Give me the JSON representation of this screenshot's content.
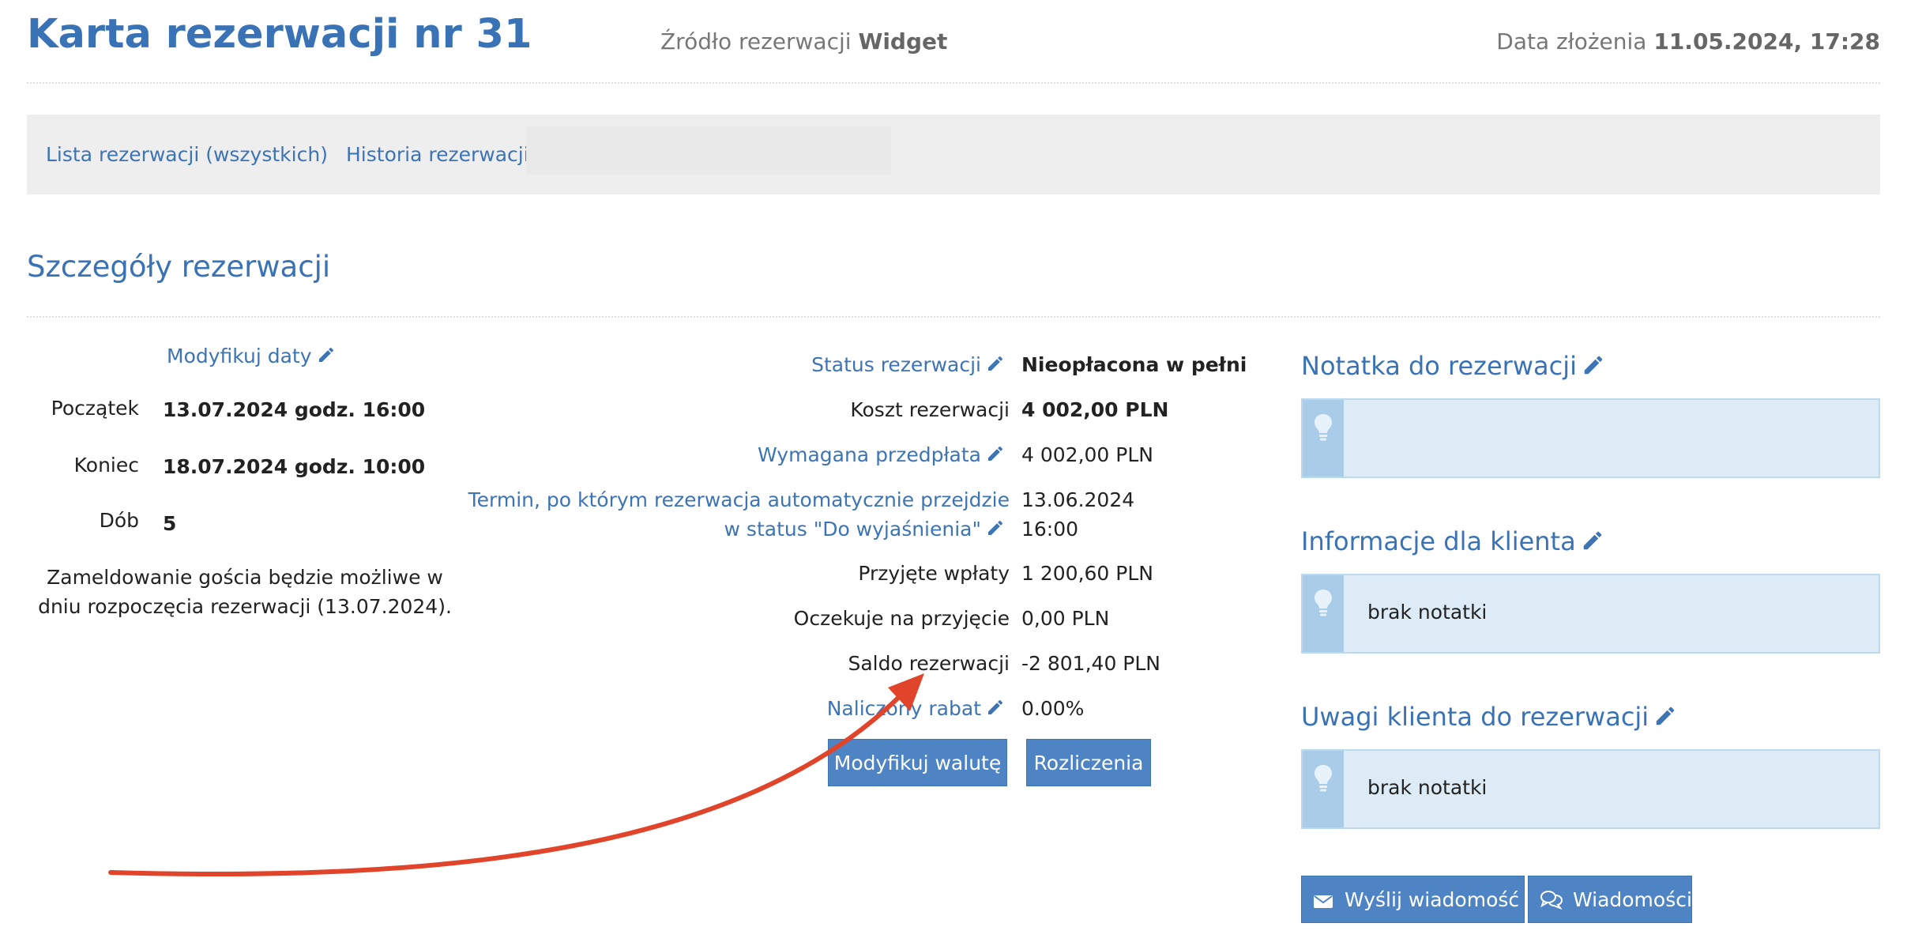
{
  "header": {
    "title": "Karta rezerwacji nr 31",
    "source_label": "Źródło rezerwacji",
    "source_value": "Widget",
    "submitted_label": "Data złożenia",
    "submitted_value": "11.05.2024, 17:28"
  },
  "nav": {
    "items": [
      "Lista rezerwacji (wszystkich)",
      "Historia rezerwacji"
    ]
  },
  "section": {
    "title": "Szczegóły rezerwacji"
  },
  "dates": {
    "modify_link": "Modyfikuj daty",
    "start_label": "Początek",
    "start_value": "13.07.2024 godz. 16:00",
    "end_label": "Koniec",
    "end_value": "18.07.2024 godz. 10:00",
    "nights_label": "Dób",
    "nights_value": "5",
    "checkin_note": "Zameldowanie gościa będzie możliwe w dniu rozpoczęcia rezerwacji (13.07.2024)."
  },
  "details": {
    "status_label": "Status rezerwacji",
    "status_value": "Nieopłacona w pełni",
    "cost_label": "Koszt rezerwacji",
    "cost_value": "4 002,00 PLN",
    "prepay_label": "Wymagana przedpłata",
    "prepay_value": "4 002,00 PLN",
    "deadline_label_1": "Termin, po którym rezerwacja automatycznie przejdzie",
    "deadline_label_2": "w status \"Do wyjaśnienia\"",
    "deadline_date": "13.06.2024",
    "deadline_time": "16:00",
    "received_label": "Przyjęte wpłaty",
    "received_value": "1 200,60 PLN",
    "pending_label": "Oczekuje na przyjęcie",
    "pending_value": "0,00 PLN",
    "balance_label": "Saldo rezerwacji",
    "balance_value": "-2 801,40 PLN",
    "discount_label": "Naliczony rabat",
    "discount_value": "0.00%",
    "currency_button": "Modyfikuj walutę",
    "settlements_button": "Rozliczenia"
  },
  "notes": {
    "booking_note_title": "Notatka do rezerwacji",
    "booking_note_text": "",
    "client_info_title": "Informacje dla klienta",
    "client_info_text": "brak notatki",
    "client_remarks_title": "Uwagi klienta do rezerwacji",
    "client_remarks_text": "brak notatki"
  },
  "messages": {
    "send_button": "Wyślij wiadomość",
    "messages_button": "Wiadomości"
  },
  "colors": {
    "accent": "#3a73b5",
    "button": "#4f84c4",
    "note_bg": "#ddebf6",
    "note_strip": "#a9cde9",
    "annotation_arrow": "#e0442b"
  }
}
